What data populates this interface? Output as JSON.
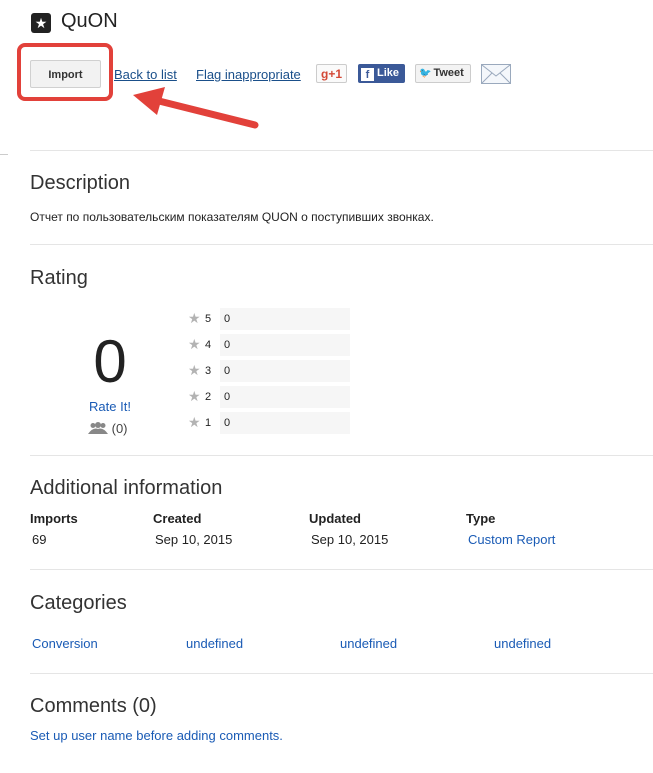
{
  "header": {
    "icon": "star-badge-icon",
    "title": "QuON"
  },
  "actions": {
    "import_label": "Import",
    "back_label": "Back to list",
    "flag_label": "Flag inappropriate",
    "gplus_label": "+1",
    "fb_label": "Like",
    "tweet_label": "Tweet",
    "mail_icon": "mail-icon",
    "highlight_color": "#e2413a"
  },
  "description": {
    "heading": "Description",
    "text": "Отчет по пользовательским показателям QUON о поступивших звонках."
  },
  "rating": {
    "heading": "Rating",
    "score": "0",
    "rate_it": "Rate It!",
    "count": "(0)",
    "rows": [
      {
        "stars": "5",
        "count": "0"
      },
      {
        "stars": "4",
        "count": "0"
      },
      {
        "stars": "3",
        "count": "0"
      },
      {
        "stars": "2",
        "count": "0"
      },
      {
        "stars": "1",
        "count": "0"
      }
    ]
  },
  "additional": {
    "heading": "Additional information",
    "imports_label": "Imports",
    "imports_value": "69",
    "created_label": "Created",
    "created_value": "Sep 10, 2015",
    "updated_label": "Updated",
    "updated_value": "Sep 10, 2015",
    "type_label": "Type",
    "type_value": "Custom Report"
  },
  "categories": {
    "heading": "Categories",
    "items": [
      "Conversion",
      "undefined",
      "undefined",
      "undefined"
    ]
  },
  "comments": {
    "heading": "Comments (0)",
    "setup_link": "Set up user name before adding comments."
  }
}
